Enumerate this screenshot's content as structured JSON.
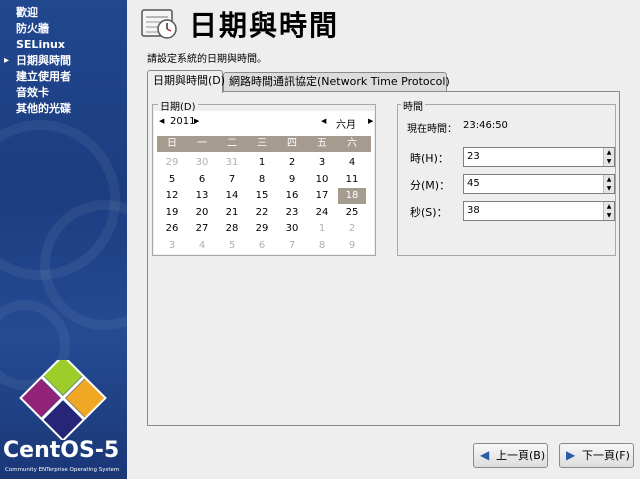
{
  "sidebar": {
    "steps": [
      {
        "label": "歡迎"
      },
      {
        "label": "防火牆"
      },
      {
        "label": "SELinux"
      },
      {
        "label": "日期與時間"
      },
      {
        "label": "建立使用者"
      },
      {
        "label": "音效卡"
      },
      {
        "label": "其他的光碟"
      }
    ],
    "logo_text": "CentOS-5",
    "logo_subtitle": "Community ENTerprise Operating System"
  },
  "header": {
    "title": "日期與時間",
    "icon": "calendar-clock-icon"
  },
  "instruction": "請設定系統的日期與時間。",
  "tabs": [
    {
      "label": "日期與時間(D)",
      "active": true
    },
    {
      "label": "網路時間通訊協定(Network Time Protocol)",
      "active": false
    }
  ],
  "date_section": {
    "label": "日期(D)",
    "year": "2011",
    "month": "六月",
    "weekdays": [
      "日",
      "一",
      "二",
      "三",
      "四",
      "五",
      "六"
    ],
    "weeks": [
      [
        "29",
        "30",
        "31",
        "1",
        "2",
        "3",
        "4"
      ],
      [
        "5",
        "6",
        "7",
        "8",
        "9",
        "10",
        "11"
      ],
      [
        "12",
        "13",
        "14",
        "15",
        "16",
        "17",
        "18"
      ],
      [
        "19",
        "20",
        "21",
        "22",
        "23",
        "24",
        "25"
      ],
      [
        "26",
        "27",
        "28",
        "29",
        "30",
        "1",
        "2"
      ],
      [
        "3",
        "4",
        "5",
        "6",
        "7",
        "8",
        "9"
      ]
    ],
    "selected_day": "18"
  },
  "time_section": {
    "label": "時間",
    "current_time_label": "現在時間：",
    "current_time_value": "23:46:50",
    "hour_label": "時(H)：",
    "hour_value": "23",
    "minute_label": "分(M)：",
    "minute_value": "45",
    "second_label": "秒(S)：",
    "second_value": "38"
  },
  "buttons": {
    "back_label": "上一頁(B)",
    "next_label": "下一頁(F)"
  },
  "colors": {
    "sidebar_bg": "#1f4388",
    "calendar_header": "#a59c8f",
    "selected_day": "#a59c8f"
  }
}
